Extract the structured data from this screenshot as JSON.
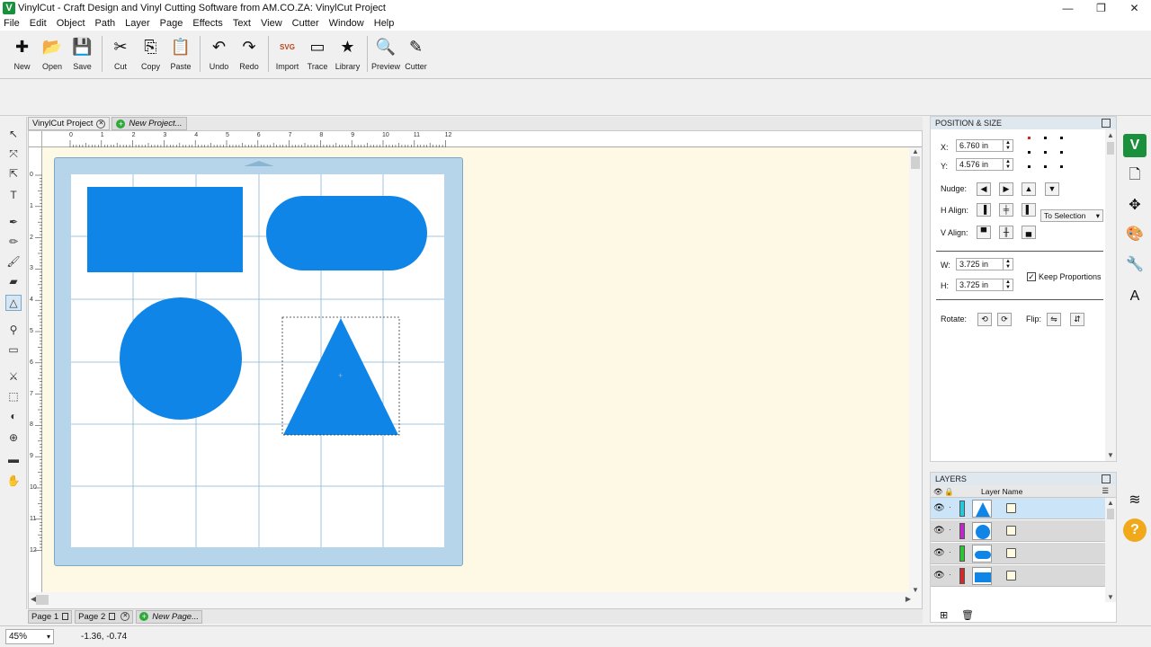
{
  "window": {
    "title": "VinylCut - Craft Design and Vinyl Cutting Software from AM.CO.ZA: VinylCut Project",
    "icon_letter": "V"
  },
  "menu": [
    "File",
    "Edit",
    "Object",
    "Path",
    "Layer",
    "Page",
    "Effects",
    "Text",
    "View",
    "Cutter",
    "Window",
    "Help"
  ],
  "toolbar": [
    {
      "label": "New",
      "icon": "new-doc-icon",
      "glyph": "✚"
    },
    {
      "label": "Open",
      "icon": "open-icon",
      "glyph": "📂"
    },
    {
      "label": "Save",
      "icon": "save-icon",
      "glyph": "💾"
    },
    {
      "label": "Cut",
      "icon": "scissors-icon",
      "glyph": "✂"
    },
    {
      "label": "Copy",
      "icon": "copy-icon",
      "glyph": "⎘"
    },
    {
      "label": "Paste",
      "icon": "paste-icon",
      "glyph": "📋"
    },
    {
      "label": "Undo",
      "icon": "undo-icon",
      "glyph": "↶"
    },
    {
      "label": "Redo",
      "icon": "redo-icon",
      "glyph": "↷"
    },
    {
      "label": "Import",
      "icon": "import-svg-icon",
      "glyph": "SVG"
    },
    {
      "label": "Trace",
      "icon": "trace-icon",
      "glyph": "▭"
    },
    {
      "label": "Library",
      "icon": "library-star-icon",
      "glyph": "★"
    },
    {
      "label": "Preview",
      "icon": "preview-magnifier-icon",
      "glyph": "🔍"
    },
    {
      "label": "Cutter",
      "icon": "cutter-blade-icon",
      "glyph": "✎"
    }
  ],
  "tools": [
    {
      "name": "select-arrow-icon",
      "glyph": "↖"
    },
    {
      "name": "node-edit-icon",
      "glyph": "⤧"
    },
    {
      "name": "direct-select-icon",
      "glyph": "⇱"
    },
    {
      "name": "text-tool-icon",
      "glyph": "T"
    },
    {
      "name": "pen-tool-icon",
      "glyph": "✒"
    },
    {
      "name": "pencil-tool-icon",
      "glyph": "✏"
    },
    {
      "name": "brush-tool-icon",
      "glyph": "🖌"
    },
    {
      "name": "eraser-tool-icon",
      "glyph": "▰"
    },
    {
      "name": "shape-tool-icon",
      "glyph": "△"
    },
    {
      "name": "eyedropper-icon",
      "glyph": "⚲"
    },
    {
      "name": "rectangle-tool-icon",
      "glyph": "▭"
    },
    {
      "name": "knife-tool-icon",
      "glyph": "⚔"
    },
    {
      "name": "transform-tool-icon",
      "glyph": "⬚"
    },
    {
      "name": "weld-tool-icon",
      "glyph": "◐"
    },
    {
      "name": "zoom-tool-icon",
      "glyph": "⊕"
    },
    {
      "name": "measure-tool-icon",
      "glyph": "▬"
    },
    {
      "name": "pan-hand-icon",
      "glyph": "✋"
    }
  ],
  "doc_tabs": {
    "active": "VinylCut Project",
    "new": "New Project..."
  },
  "ruler": {
    "h_labels": [
      "0",
      "1",
      "2",
      "3",
      "4",
      "5",
      "6",
      "7",
      "8",
      "9",
      "10",
      "11",
      "12"
    ],
    "v_labels": [
      "0",
      "1",
      "2",
      "3",
      "4",
      "5",
      "6",
      "7",
      "8",
      "9",
      "10",
      "11",
      "12"
    ]
  },
  "shapes": {
    "fill": "#1085e8"
  },
  "page_tabs": {
    "page1": "Page 1",
    "page2": "Page 2",
    "new": "New Page..."
  },
  "status": {
    "zoom": "45%",
    "coords": "-1.36, -0.74"
  },
  "position_panel": {
    "title": "POSITION & SIZE",
    "x_label": "X:",
    "x_value": "6.760 in",
    "y_label": "Y:",
    "y_value": "4.576 in",
    "nudge_label": "Nudge:",
    "halign_label": "H Align:",
    "valign_label": "V Align:",
    "align_mode": "To Selection",
    "w_label": "W:",
    "w_value": "3.725 in",
    "h_label": "H:",
    "h_value": "3.725 in",
    "keep_proportions": "Keep Proportions",
    "rotate_label": "Rotate:",
    "flip_label": "Flip:"
  },
  "layers_panel": {
    "title": "LAYERS",
    "column": "Layer Name",
    "rows": [
      {
        "color": "#27c9d6",
        "shape": "triangle"
      },
      {
        "color": "#c027c9",
        "shape": "circle"
      },
      {
        "color": "#2ec43a",
        "shape": "rounded-rect"
      },
      {
        "color": "#d12a2a",
        "shape": "rect"
      }
    ]
  }
}
